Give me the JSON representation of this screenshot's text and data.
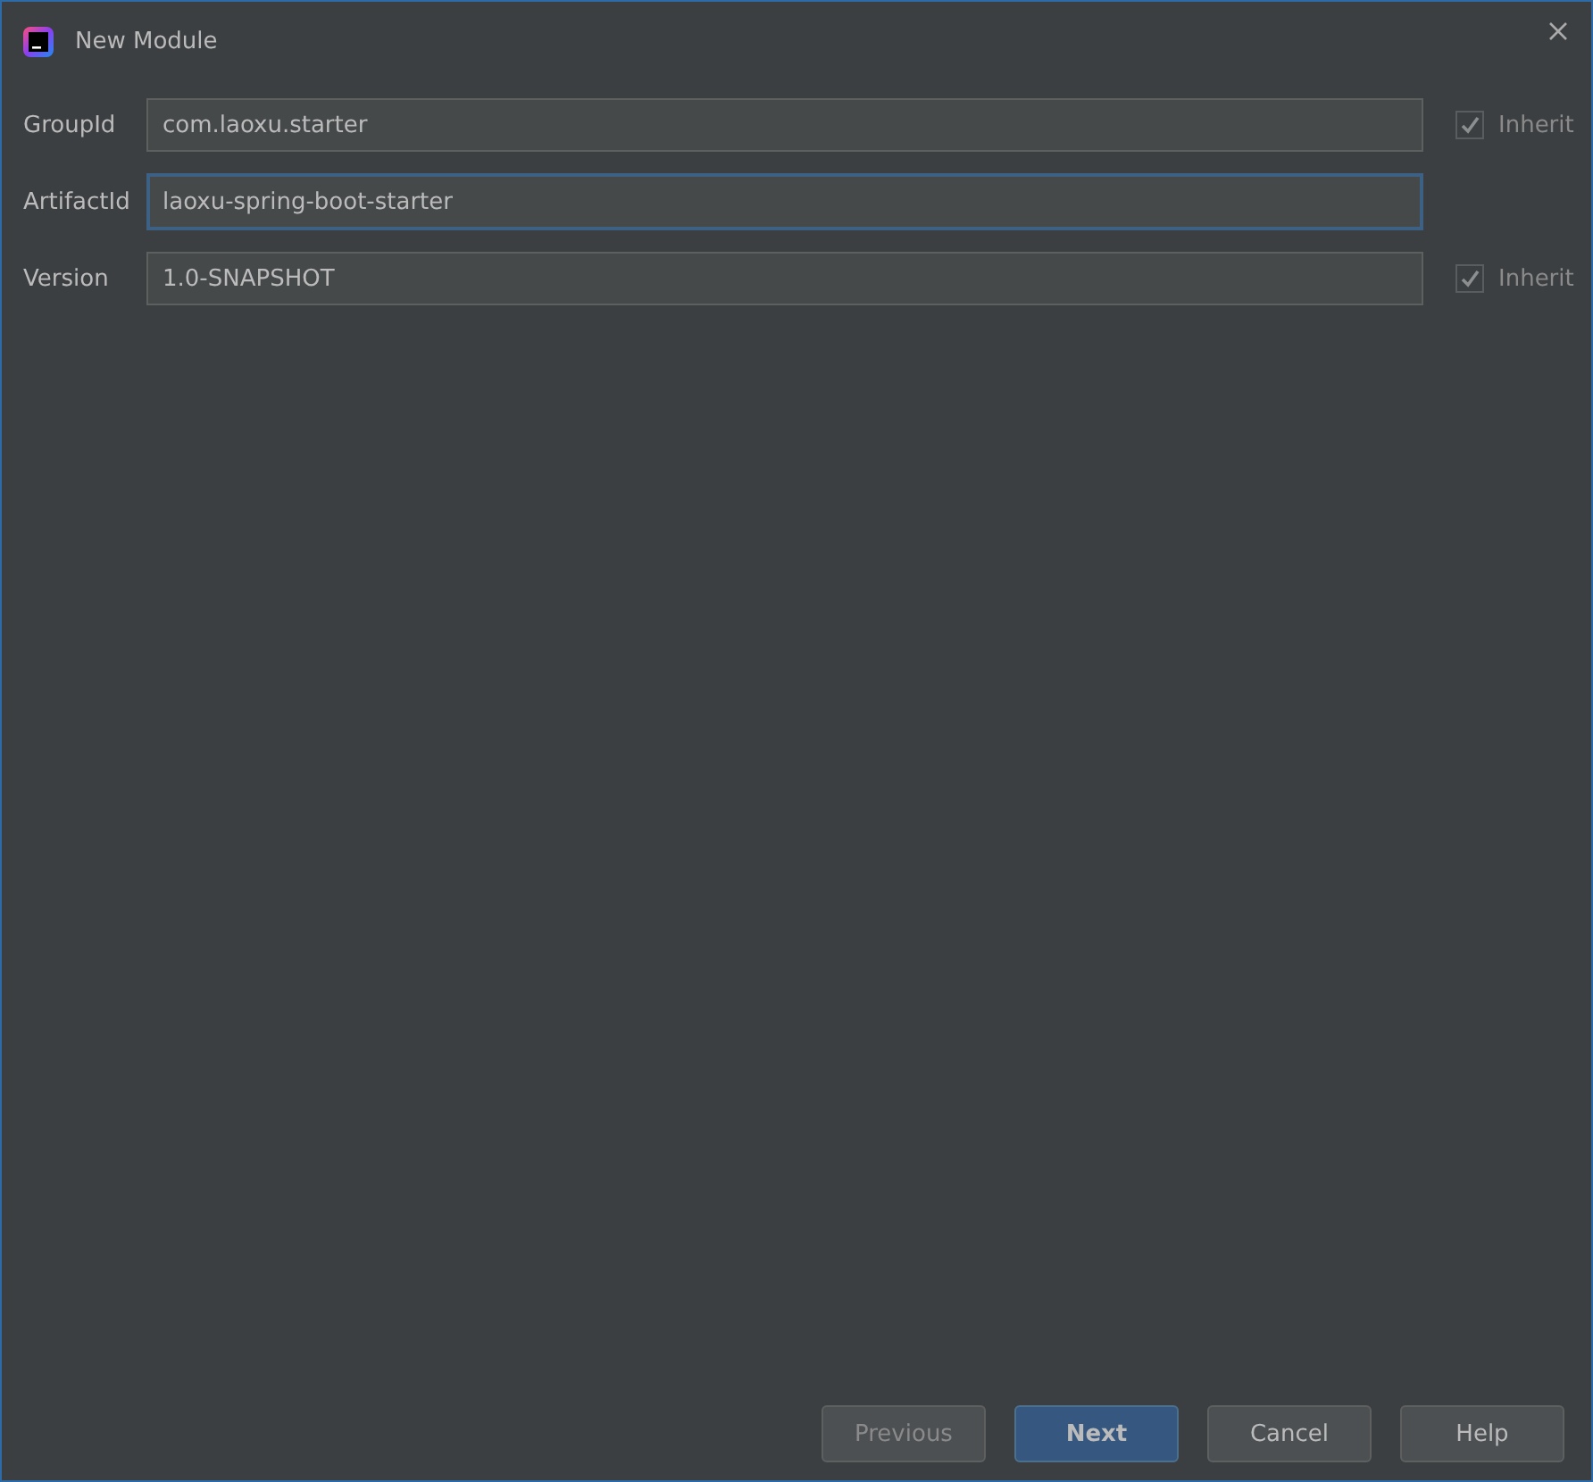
{
  "window": {
    "title": "New Module"
  },
  "fields": [
    {
      "label": "GroupId",
      "value": "com.laoxu.starter",
      "focused": false,
      "inherit": {
        "label": "Inherit",
        "checked": true,
        "disabled": true
      }
    },
    {
      "label": "ArtifactId",
      "value": "laoxu-spring-boot-starter",
      "focused": true
    },
    {
      "label": "Version",
      "value": "1.0-SNAPSHOT",
      "focused": false,
      "inherit": {
        "label": "Inherit",
        "checked": true,
        "disabled": true
      }
    }
  ],
  "buttons": [
    {
      "label": "Previous",
      "kind": "normal",
      "disabled": true
    },
    {
      "label": "Next",
      "kind": "default",
      "disabled": false
    },
    {
      "label": "Cancel",
      "kind": "normal",
      "disabled": false
    },
    {
      "label": "Help",
      "kind": "normal",
      "disabled": false
    }
  ]
}
